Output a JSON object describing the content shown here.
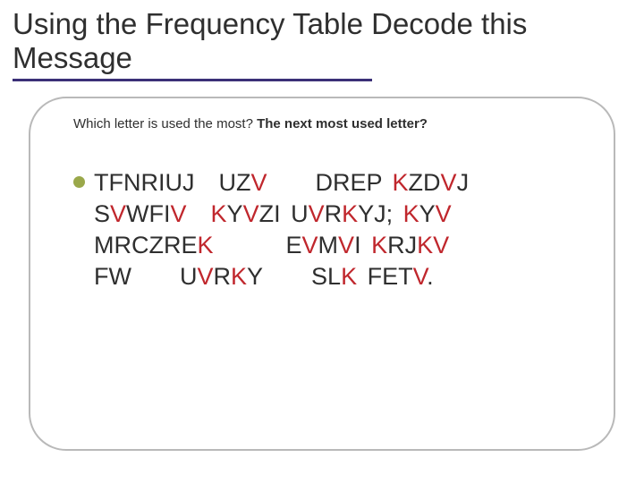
{
  "title": "Using the Frequency Table Decode this Message",
  "subtitle": {
    "part1": "Which letter is used the most? ",
    "part2": "The next most used letter?"
  },
  "cipher": {
    "segments": [
      {
        "t": "TFNRIUJ UZ",
        "hl": false
      },
      {
        "t": "V",
        "hl": true
      },
      {
        "t": "  DREP ",
        "hl": false
      },
      {
        "t": "K",
        "hl": true
      },
      {
        "t": "ZD",
        "hl": false
      },
      {
        "t": "V",
        "hl": true
      },
      {
        "t": "J S",
        "hl": false
      },
      {
        "t": "V",
        "hl": true
      },
      {
        "t": "WFI",
        "hl": false
      },
      {
        "t": "V",
        "hl": true
      },
      {
        "t": " ",
        "hl": false
      },
      {
        "t": "K",
        "hl": true
      },
      {
        "t": "Y",
        "hl": false
      },
      {
        "t": "V",
        "hl": true
      },
      {
        "t": "ZI U",
        "hl": false
      },
      {
        "t": "V",
        "hl": true
      },
      {
        "t": "R",
        "hl": false
      },
      {
        "t": "K",
        "hl": true
      },
      {
        "t": "YJ; ",
        "hl": false
      },
      {
        "t": "K",
        "hl": true
      },
      {
        "t": "Y",
        "hl": false
      },
      {
        "t": "V",
        "hl": true
      },
      {
        "t": "  MRCZRE",
        "hl": false
      },
      {
        "t": "K",
        "hl": true
      },
      {
        "t": "   E",
        "hl": false
      },
      {
        "t": "V",
        "hl": true
      },
      {
        "t": "M",
        "hl": false
      },
      {
        "t": "V",
        "hl": true
      },
      {
        "t": "I ",
        "hl": false
      },
      {
        "t": "K",
        "hl": true
      },
      {
        "t": "RJ",
        "hl": false
      },
      {
        "t": "KV",
        "hl": true
      },
      {
        "t": "  FW  U",
        "hl": false
      },
      {
        "t": "V",
        "hl": true
      },
      {
        "t": "R",
        "hl": false
      },
      {
        "t": "K",
        "hl": true
      },
      {
        "t": "Y  SL",
        "hl": false
      },
      {
        "t": "K",
        "hl": true
      },
      {
        "t": " FET",
        "hl": false
      },
      {
        "t": "V",
        "hl": true
      },
      {
        "t": ".",
        "hl": false
      }
    ]
  },
  "colors": {
    "accent_purple": "#3b3077",
    "bullet_green": "#9aa84a",
    "highlight_red": "#c0272d"
  }
}
